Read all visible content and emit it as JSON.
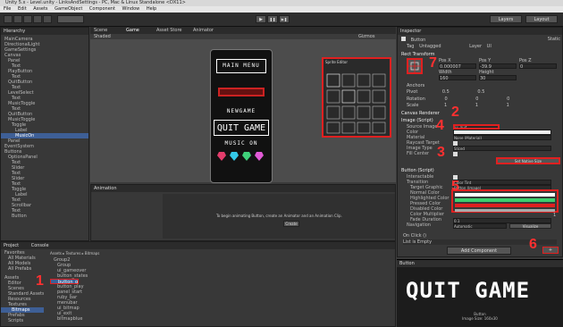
{
  "window": {
    "title": "Unity 5.x - Level.unity - LinksAndSettings - PC, Mac & Linux Standalone <DX11>"
  },
  "menubar": [
    "File",
    "Edit",
    "Assets",
    "GameObject",
    "Component",
    "Window",
    "Help"
  ],
  "hierarchy": {
    "tab": "Hierarchy",
    "items": [
      "MainCamera",
      "DirectionalLight",
      "GameSettings",
      "Canvas",
      "Panel",
      "Text",
      "PlayButton",
      "Text",
      "QuitButton",
      "Text",
      "LevelSelect",
      "Text",
      "MusicToggle",
      "Text",
      "QuitButton",
      "MusicToggle",
      "Toggle",
      "Label",
      "MusicOn",
      "Panel",
      "EventSystem",
      "Buttons",
      "OptionsPanel",
      "Text",
      "Slider",
      "Text",
      "Slider",
      "Text",
      "Toggle",
      "Label",
      "Text",
      "Scrollbar",
      "Text",
      "Button"
    ],
    "selected_index": 18
  },
  "scene": {
    "tab_scene": "Scene",
    "tab_game": "Game",
    "tab_asset_store": "Asset Store",
    "tab_animator": "Animator",
    "shaded": "Shaded",
    "gizmos": "Gizmos"
  },
  "game_view": {
    "main_menu": "MAIN MENU",
    "new_game": "NEWGAME",
    "quit_game": "QUIT GAME",
    "music_on": "MUSIC ON",
    "colors": {
      "ruby": "#e23c6b",
      "cyan": "#34c8e8",
      "green": "#3fd07a",
      "pink": "#e15ad6"
    }
  },
  "sprite_editor": {
    "title": "Sprite Editor"
  },
  "animation": {
    "tab": "Animation",
    "message": "To begin animating Button, create an Animator and an Animation Clip.",
    "create_button": "Create"
  },
  "project": {
    "tab_project": "Project",
    "tab_console": "Console",
    "breadcrumb": [
      "Assets",
      "Textures",
      "Bitmaps"
    ],
    "favorites": [
      "Favorites",
      "All Materials",
      "All Models",
      "All Prefabs"
    ],
    "tree": [
      "Assets",
      "Editor",
      "Scenes",
      "Standard Assets",
      "Resources",
      "Textures",
      "Bitmaps",
      "Prefabs",
      "Scripts"
    ],
    "files": [
      "Group2",
      "Group",
      "ui_gameover",
      "button_states",
      "button_quit",
      "button_play",
      "panel_start",
      "ruby_bar",
      "menubar",
      "ui_bitmap",
      "ui_exit",
      "bitmapblue"
    ]
  },
  "inspector": {
    "tab": "Inspector",
    "object_name": "Button",
    "static": "Static",
    "tag_label": "Tag",
    "tag_value": "Untagged",
    "layer_label": "Layer",
    "layer_value": "UI",
    "rect_transform": "Rect Transform",
    "pos_labels": [
      "Pos X",
      "Pos Y",
      "Pos Z"
    ],
    "pos_values": [
      "0.000007",
      "-39.9",
      "0"
    ],
    "size_labels": [
      "Width",
      "Height"
    ],
    "size_values": [
      "160",
      "30"
    ],
    "anchors": "Anchors",
    "pivot_label": "Pivot",
    "pivot_values": [
      "0.5",
      "0.5"
    ],
    "rotation_label": "Rotation",
    "rotation_values": [
      "0",
      "0",
      "0"
    ],
    "scale_label": "Scale",
    "scale_values": [
      "1",
      "1",
      "1"
    ],
    "canvas_renderer": "Canvas Renderer",
    "image_script": "Image (Script)",
    "image_fields": [
      "Source Image",
      "Color",
      "Material",
      "Raycast Target",
      "Image Type",
      "Fill Center"
    ],
    "source_image_value": "ui_quit",
    "material_value": "None (Material)",
    "image_type_value": "Sliced",
    "set_native_size": "Set Native Size",
    "button_script": "Button (Script)",
    "button_fields": [
      "Interactable",
      "Transition",
      "Target Graphic",
      "Normal Color",
      "Highlighted Color",
      "Pressed Color",
      "Disabled Color",
      "Color Multiplier",
      "Fade Duration"
    ],
    "transition_value": "Color Tint",
    "target_graphic_value": "Button (Image)",
    "color_multiplier": "1",
    "fade_duration": "0.1",
    "navigation_label": "Navigation",
    "navigation_value": "Automatic",
    "visualize": "Visualize",
    "on_click": "On Click ()",
    "list_empty": "List is Empty",
    "add_component": "Add Component"
  },
  "preview": {
    "label": "Button",
    "text": "QUIT GAME",
    "caption_title": "Button",
    "caption_size": "Image Size: 160x30"
  },
  "toolbar": {
    "play": "▶",
    "pause": "❚❚",
    "step": "▶❚",
    "layers": "Layers",
    "layout": "Layout"
  },
  "annotations": [
    "1",
    "2",
    "3",
    "4",
    "5",
    "6",
    "7"
  ],
  "accent": "#e02020"
}
